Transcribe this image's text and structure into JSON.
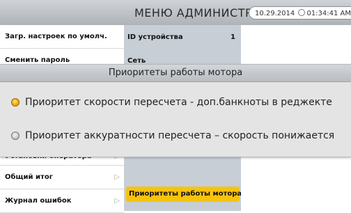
{
  "header": {
    "title": "МЕНЮ АДМИНИСТР.",
    "date": "10.29.2014",
    "time": "01:34:41 AM"
  },
  "left_menu": {
    "items": [
      {
        "label": "Загр. настроек по умолч."
      },
      {
        "label": "Сменить пароль"
      },
      {
        "label": "Установки оператора"
      },
      {
        "label": "Общий итог"
      },
      {
        "label": "Журнал ошибок"
      }
    ]
  },
  "right_panel": {
    "device_id_label": "ID устройства",
    "device_id_value": "1",
    "network_label": "Сеть",
    "selected_item": "Приоритеты работы мотора"
  },
  "dialog": {
    "title": "Приоритеты работы мотора",
    "options": [
      {
        "label": "Приоритет скорости пересчета - доп.банкноты в реджекте",
        "selected": true
      },
      {
        "label": "Приоритет аккуратности пересчета – скорость понижается",
        "selected": false
      }
    ]
  },
  "colors": {
    "accent": "#f6c30e",
    "panel": "#c7ced5",
    "header": "#bcc1c6"
  }
}
